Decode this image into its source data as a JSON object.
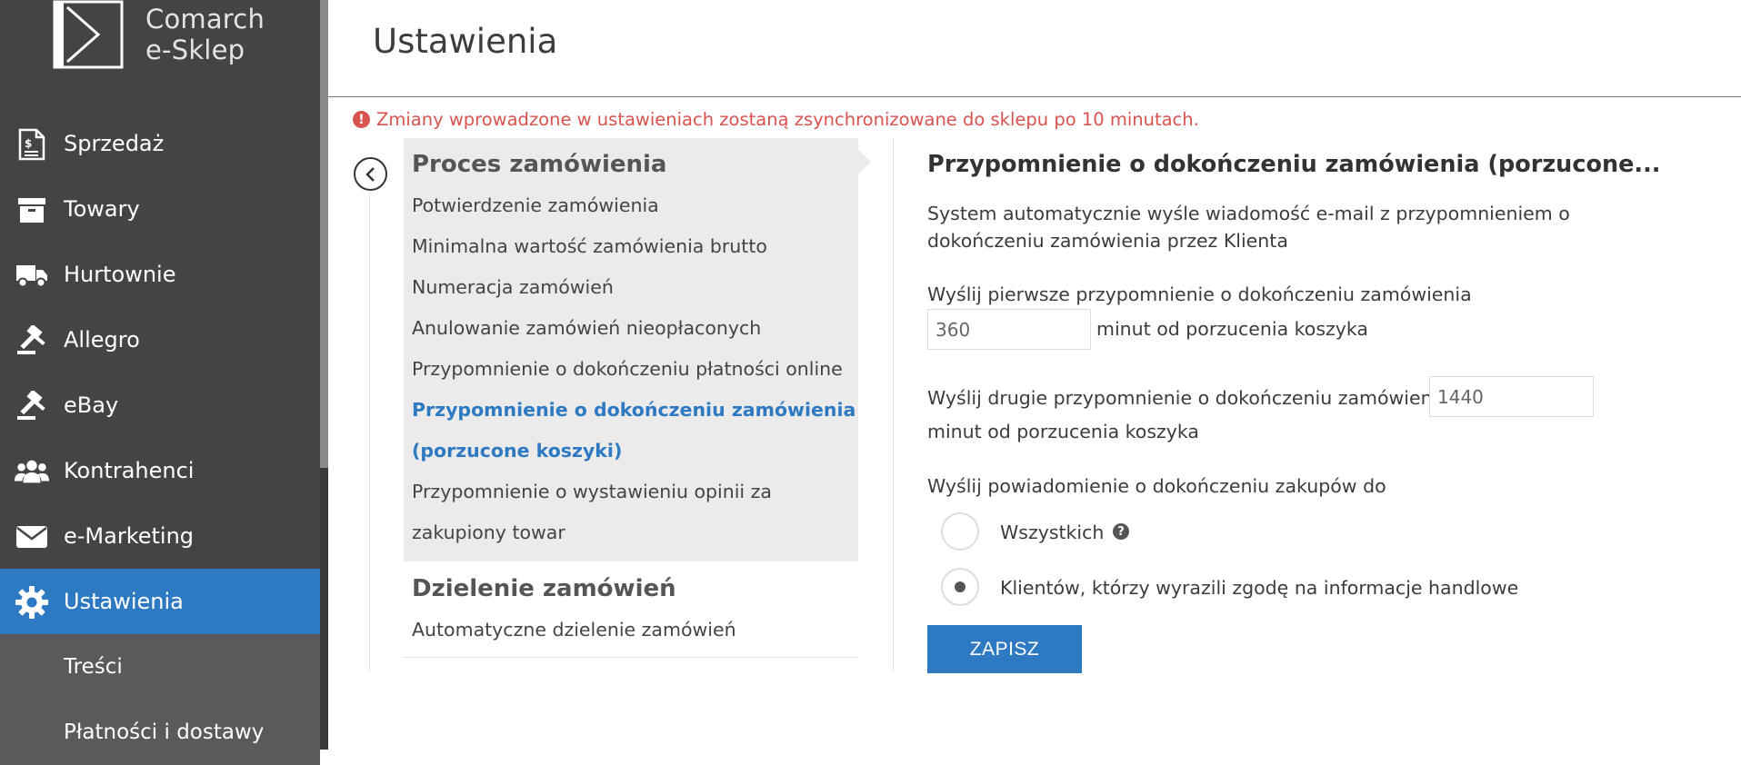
{
  "brand": {
    "name_line1": "Comarch",
    "name_line2": "e-Sklep"
  },
  "sidebar": {
    "items": [
      {
        "label": "Sprzedaż",
        "icon": "document-dollar-icon"
      },
      {
        "label": "Towary",
        "icon": "archive-box-icon"
      },
      {
        "label": "Hurtownie",
        "icon": "truck-icon"
      },
      {
        "label": "Allegro",
        "icon": "gavel-icon"
      },
      {
        "label": "eBay",
        "icon": "gavel-icon"
      },
      {
        "label": "Kontrahenci",
        "icon": "users-icon"
      },
      {
        "label": "e-Marketing",
        "icon": "envelope-icon"
      },
      {
        "label": "Ustawienia",
        "icon": "gear-icon",
        "active": true
      }
    ],
    "subitems": [
      {
        "label": "Treści"
      },
      {
        "label": "Płatności i dostawy"
      }
    ]
  },
  "header": {
    "title": "Ustawienia"
  },
  "alert": {
    "text": "Zmiany wprowadzone w ustawieniach zostaną zsynchronizowane do sklepu po 10 minutach."
  },
  "menu": {
    "section1": {
      "heading": "Proces zamówienia",
      "links": [
        "Potwierdzenie zamówienia",
        "Minimalna wartość zamówienia brutto",
        "Numeracja zamówień",
        "Anulowanie zamówień nieopłaconych",
        "Przypomnienie o dokończeniu płatności online",
        "Przypomnienie o dokończeniu zamówienia",
        "(porzucone koszyki)",
        "Przypomnienie o wystawieniu opinii za",
        "zakupiony towar"
      ]
    },
    "section2": {
      "heading": "Dzielenie zamówień",
      "links": [
        "Automatyczne dzielenie zamówień"
      ]
    }
  },
  "detail": {
    "title": "Przypomnienie o dokończeniu zamówienia (porzucone...",
    "description": "System automatycznie wyśle wiadomość e-mail z przypomnieniem o dokończeniu zamówienia przez Klienta",
    "first_label": "Wyślij pierwsze przypomnienie o dokończeniu zamówienia",
    "first_value": "360",
    "first_suffix": "minut od porzucenia koszyka",
    "second_label": "Wyślij drugie przypomnienie o dokończeniu zamówienia",
    "second_value": "1440",
    "second_suffix": "minut od porzucenia koszyka",
    "notify_label": "Wyślij powiadomienie o dokończeniu zakupów do",
    "radio_all": "Wszystkich",
    "radio_consent": "Klientów, którzy wyrazili zgodę na informacje handlowe",
    "help_icon": "question-icon",
    "save_label": "ZAPISZ"
  },
  "colors": {
    "accent": "#2d79c2",
    "sidebar_bg": "#444444",
    "alert": "#d9534f"
  }
}
